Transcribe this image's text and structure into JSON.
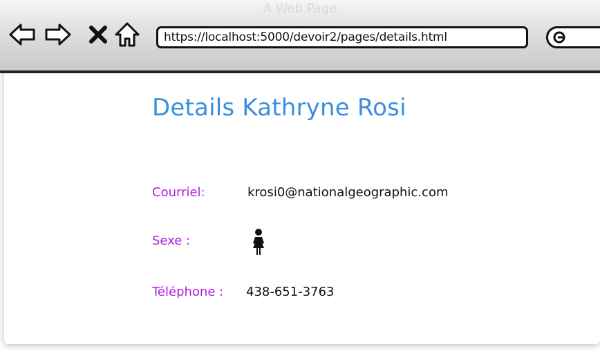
{
  "window": {
    "title": "A Web Page"
  },
  "toolbar": {
    "url": "https://localhost:5000/devoir2/pages/details.html",
    "icons": [
      "back-arrow-icon",
      "forward-arrow-icon",
      "close-x-icon",
      "home-icon",
      "search-icon"
    ]
  },
  "page": {
    "title": "Details Kathryne Rosi",
    "fields": {
      "email_label": "Courriel:",
      "email_value": "krosi0@nationalgeographic.com",
      "sex_label": "Sexe :",
      "sex_icon": "female-icon",
      "phone_label": "Téléphone :",
      "phone_value": "438-651-3763"
    }
  },
  "colors": {
    "title": "#3a8ee0",
    "label": "#b01ee0",
    "text": "#111111"
  }
}
